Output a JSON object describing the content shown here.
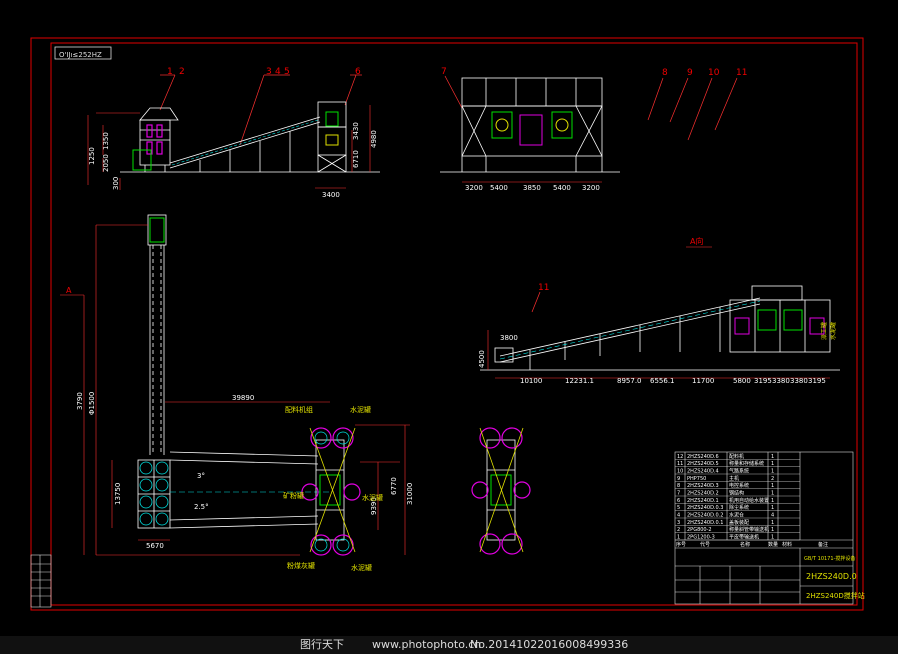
{
  "drawing": {
    "stamp_tl": "O'Ĳı≤252HZ",
    "part_numbers_top": [
      "1",
      "2",
      "3",
      "4",
      "5",
      "6",
      "7",
      "8",
      "9",
      "10",
      "11"
    ],
    "side_dims": [
      "1250",
      "1350",
      "2050",
      "300",
      "3400",
      "6710",
      "4980",
      "3430"
    ],
    "front_dims": [
      "3200",
      "5400",
      "3850",
      "5400",
      "3200"
    ],
    "plan_dims": [
      "3790",
      "Φ1500",
      "39890",
      "5670",
      "13750",
      "6770",
      "9390",
      "31000",
      "2.5°",
      "3°"
    ],
    "plan_labels": [
      "配料机组",
      "水泥罐",
      "矿粉罐",
      "水泥罐",
      "粉煤灰罐",
      "水泥罐"
    ],
    "view_a_label": "A向",
    "marker_a": "A",
    "view_a_dims": [
      "3800",
      "4500",
      "10100",
      "12231.1",
      "8957.0",
      "6556.1",
      "11700",
      "5800",
      "3195",
      "3380",
      "3380",
      "3195"
    ],
    "elev_labels": [
      "派工罐",
      "水泥罐"
    ],
    "title_block": {
      "drawing_no": "2HZS240D.0",
      "name": "2HZS240D搅拌站",
      "upper_note": "GB/T 10171-搅拌设备",
      "rows": [
        [
          "2HZS240D.6",
          "配料机",
          "1"
        ],
        [
          "2HZS240D.5",
          "称量和存储系统",
          "1"
        ],
        [
          "2HZS240D.4",
          "气路系统",
          "1"
        ],
        [
          "PHP750",
          "主机",
          "2"
        ],
        [
          "2HZS240D.3",
          "电控系统",
          "1"
        ],
        [
          "2HZS240D.2",
          "钢结构",
          "1"
        ],
        [
          "2HZS240D.1",
          "机用自动给水装置",
          "1"
        ],
        [
          "2HZS240D.0.3",
          "除尘系统",
          "1"
        ],
        [
          "2HZS240D.0.2",
          "水泥仓",
          "4"
        ],
        [
          "2HZS240D.0.1",
          "盖板装配",
          "1"
        ],
        [
          "2PG800-2",
          "称量斜管带输送机",
          "1"
        ],
        [
          "2PG1200-3",
          "平皮带输送机",
          "1"
        ]
      ],
      "headers": [
        "序号",
        "代号",
        "名称",
        "数量",
        "材料",
        "备注"
      ]
    }
  },
  "footer": {
    "site": "图行天下",
    "url": "www.photophoto.cn",
    "number": "No.20141022016008499336"
  },
  "colors": {
    "frame": "#e00000",
    "structure": "#ffffff",
    "accent_green": "#00e000",
    "accent_cyan": "#00e0e0",
    "accent_magenta": "#e000e0",
    "accent_yellow": "#e0e000",
    "dim_red": "#ff3030"
  }
}
